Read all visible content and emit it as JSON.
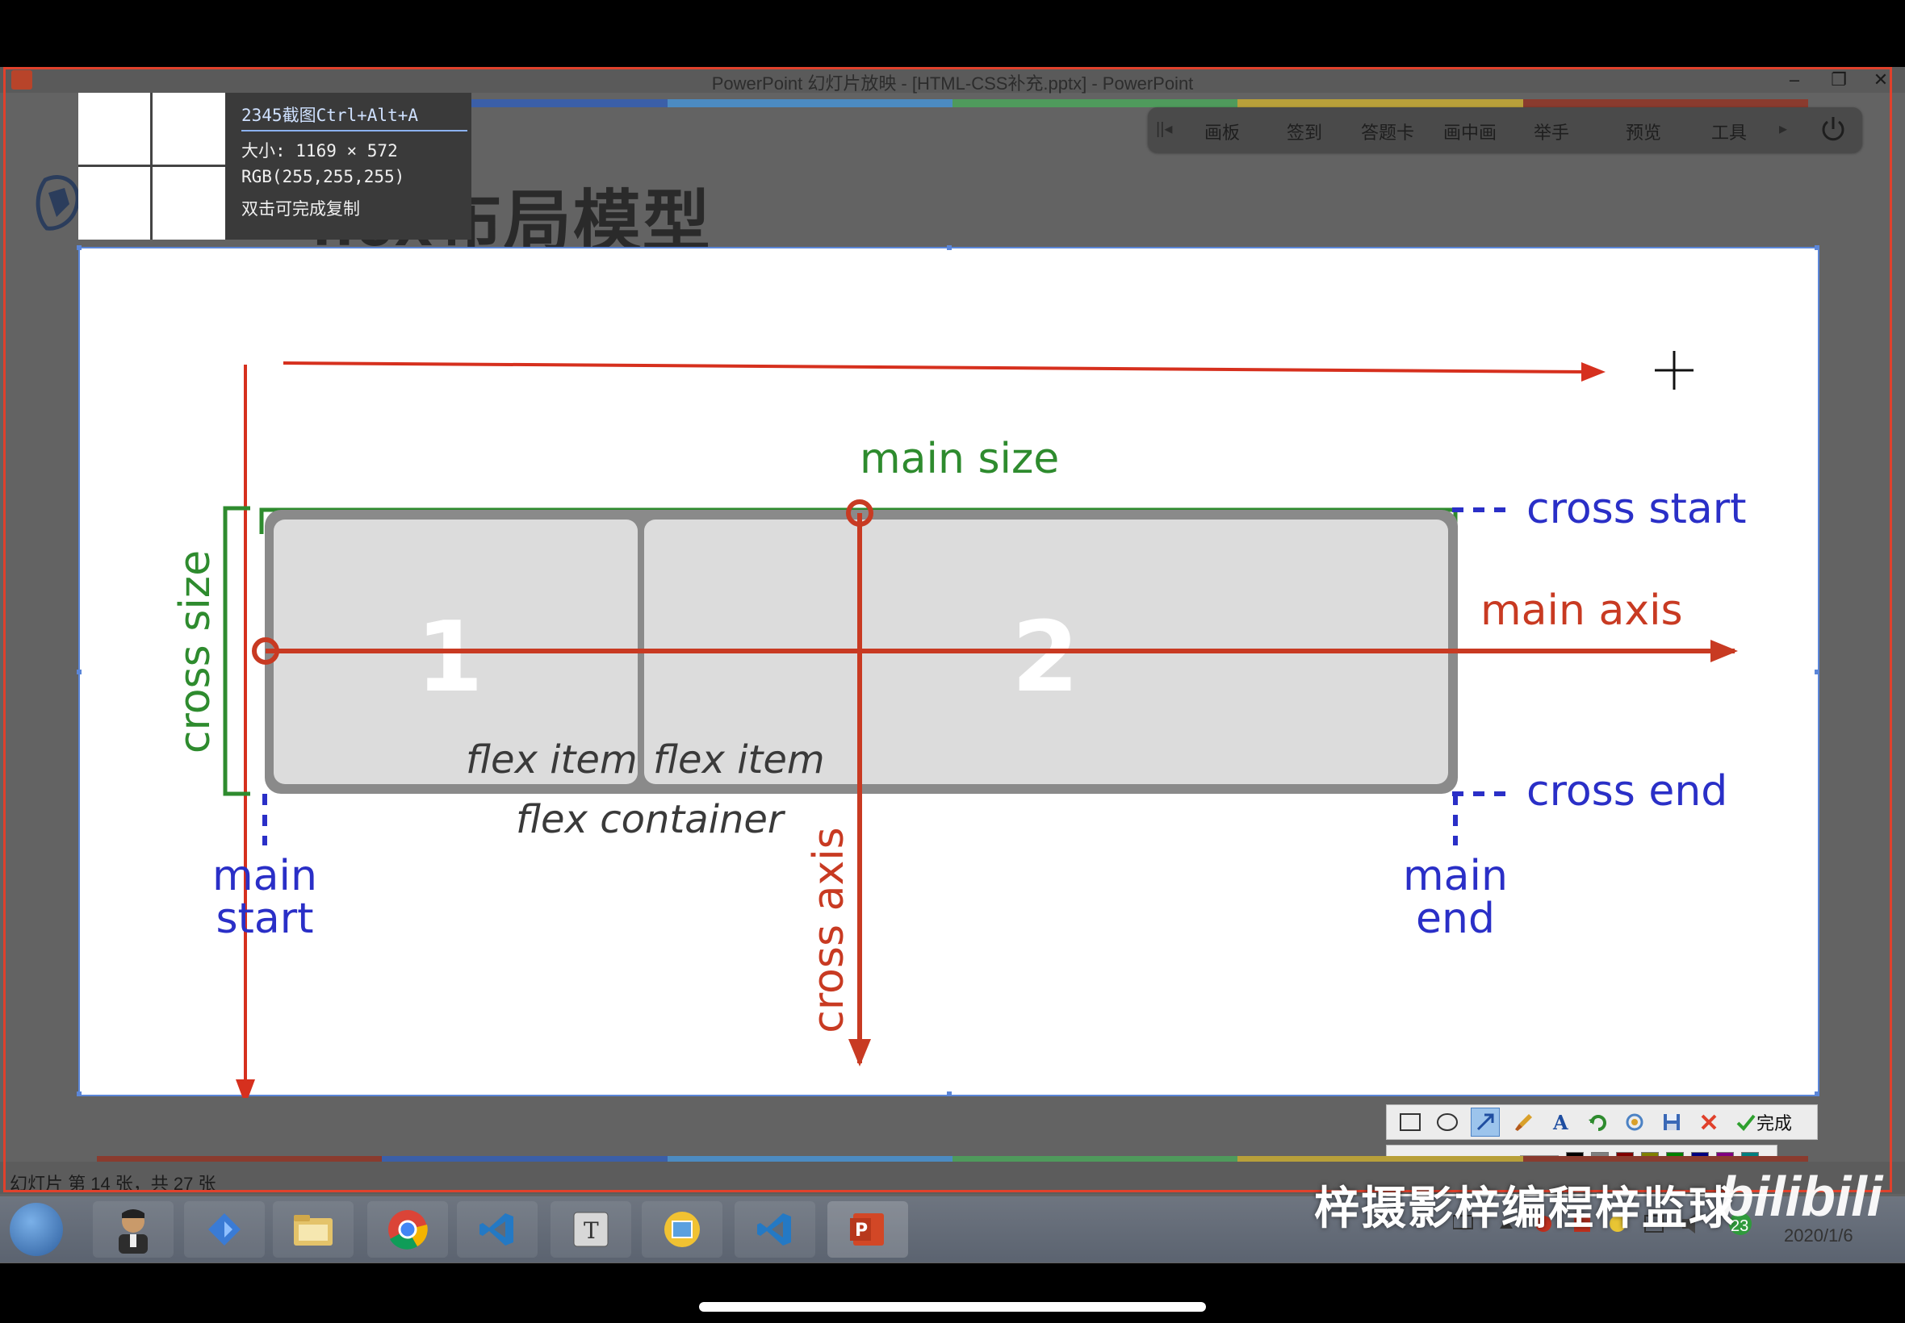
{
  "window": {
    "title": "PowerPoint 幻灯片放映 - [HTML-CSS补充.pptx] - PowerPoint",
    "minimize_glyph": "–",
    "restore_glyph": "❐",
    "close_glyph": "✕"
  },
  "slide_toolbar": {
    "items": [
      "画板",
      "签到",
      "答题卡",
      "画中画",
      "举手",
      "预览",
      "工具"
    ],
    "left_arrow": "||◂",
    "right_arrow": "▸",
    "power_icon": "power-icon"
  },
  "slide": {
    "title": "flex布局模型"
  },
  "screenshot_tool": {
    "title": "2345截图Ctrl+Alt+A",
    "size": "大小: 1169 × 572",
    "rgb": "RGB(255,255,255)",
    "hint": "双击可完成复制"
  },
  "diagram": {
    "labels": {
      "main_size": "main size",
      "cross_size": "cross size",
      "cross_start": "cross start",
      "cross_end": "cross end",
      "main_axis": "main axis",
      "cross_axis": "cross axis",
      "main_start_1": "main",
      "main_start_2": "start",
      "main_end_1": "main",
      "main_end_2": "end",
      "flex_item_1": "flex item",
      "flex_item_2": "flex item",
      "flex_container": "flex container",
      "item_1_number": "1",
      "item_2_number": "2"
    },
    "colors": {
      "red": "#c83a22",
      "blue": "#2a2fc7",
      "green": "#2e8b2e",
      "container_border": "#8a8a8a",
      "item_fill": "#dcdcdc"
    }
  },
  "draw_toolbar": {
    "tools": [
      "rectangle-icon",
      "ellipse-icon",
      "arrow-icon",
      "brush-icon",
      "text-icon",
      "undo-icon",
      "redo-icon",
      "save-icon",
      "cancel-icon"
    ],
    "done_label": "完成"
  },
  "palette": {
    "current_color": "#e6301e",
    "colors": [
      "#000000",
      "#7f7f7f",
      "#800000",
      "#808000",
      "#008000",
      "#000080",
      "#800080",
      "#008080",
      "#ffffff",
      "#c0c0c0",
      "#ff0000",
      "#ffff00",
      "#00ff00",
      "#0000ff",
      "#ff00ff",
      "#00ffff"
    ]
  },
  "statusbar": {
    "text": "幻灯片 第 14 张，共 27 张"
  },
  "taskbar": {
    "apps": [
      "start-orb",
      "user-avatar",
      "kite-app-icon",
      "file-explorer-icon",
      "chrome-icon",
      "vscode-icon",
      "typora-icon",
      "screenshot-app-icon",
      "vscode-icon-2",
      "powerpoint-icon"
    ],
    "tray_badge": "23",
    "date": "2020/1/6"
  },
  "watermark": {
    "text": "梓摄影梓编程梓监球",
    "logo": "bilibili"
  }
}
